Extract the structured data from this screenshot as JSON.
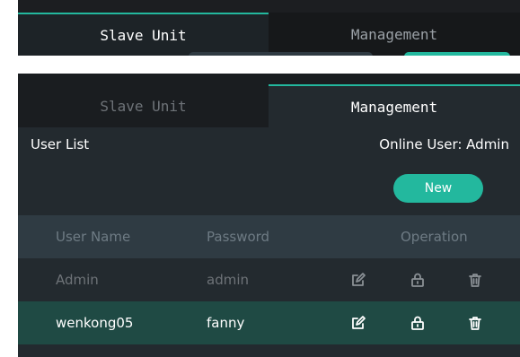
{
  "top_strip": {
    "tabs": [
      {
        "label": "Slave Unit"
      },
      {
        "label": "Management"
      }
    ]
  },
  "tabs": [
    {
      "label": "Slave Unit",
      "active": false
    },
    {
      "label": "Management",
      "active": true
    }
  ],
  "management": {
    "user_list_label": "User List",
    "online_user": "Online User: Admin",
    "new_button": "New",
    "table": {
      "headers": {
        "user_name": "User Name",
        "password": "Password",
        "operation": "Operation"
      },
      "rows": [
        {
          "user_name": "Admin",
          "password": "admin",
          "selected": false,
          "icons": [
            "edit-icon",
            "lock-icon",
            "delete-icon"
          ]
        },
        {
          "user_name": "wenkong05",
          "password": "fanny",
          "selected": true,
          "icons": [
            "edit-icon",
            "lock-icon",
            "delete-icon"
          ]
        }
      ]
    }
  },
  "colors": {
    "accent": "#23b89e",
    "panel_bg": "#1a1d20",
    "content_bg": "#232a2f",
    "header_bg": "#2f3b43",
    "selected_row_bg": "#1f4a44"
  }
}
